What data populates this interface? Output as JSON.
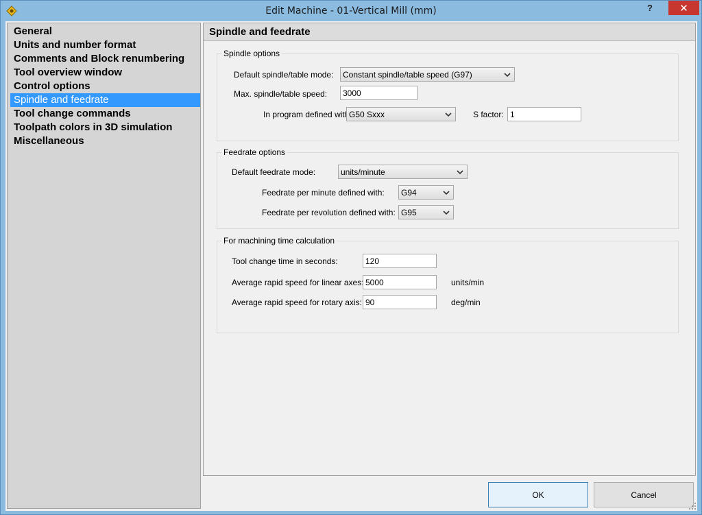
{
  "window": {
    "title": "Edit Machine - 01-Vertical Mill (mm)",
    "help_label": "?",
    "close_label": "✕"
  },
  "nav": {
    "items": [
      {
        "label": "General"
      },
      {
        "label": "Units and number format"
      },
      {
        "label": "Comments and Block renumbering"
      },
      {
        "label": "Tool overview window"
      },
      {
        "label": "Control options"
      },
      {
        "label": "Spindle and feedrate",
        "selected": true
      },
      {
        "label": "Tool change commands"
      },
      {
        "label": "Toolpath colors in 3D simulation"
      },
      {
        "label": "Miscellaneous"
      }
    ]
  },
  "panel": {
    "title": "Spindle and feedrate",
    "spindle": {
      "group_title": "Spindle options",
      "mode_label": "Default spindle/table mode:",
      "mode_value": "Constant spindle/table speed (G97)",
      "max_label": "Max. spindle/table speed:",
      "max_value": "3000",
      "defined_label": "In program defined with:",
      "defined_value": "G50 Sxxx",
      "sfactor_label": "S factor:",
      "sfactor_value": "1"
    },
    "feedrate": {
      "group_title": "Feedrate options",
      "mode_label": "Default feedrate mode:",
      "mode_value": "units/minute",
      "per_min_label": "Feedrate per minute defined with:",
      "per_min_value": "G94",
      "per_rev_label": "Feedrate per revolution defined with:",
      "per_rev_value": "G95"
    },
    "machining": {
      "group_title": "For machining time calculation",
      "toolchange_label": "Tool change time in seconds:",
      "toolchange_value": "120",
      "linear_label": "Average rapid speed for linear axes:",
      "linear_value": "5000",
      "linear_unit": "units/min",
      "rotary_label": "Average rapid speed for rotary axis:",
      "rotary_value": "90",
      "rotary_unit": "deg/min"
    }
  },
  "footer": {
    "ok_label": "OK",
    "cancel_label": "Cancel"
  },
  "colors": {
    "frame": "#8cbbe0",
    "selection": "#3399ff",
    "close_button": "#c7372f"
  }
}
